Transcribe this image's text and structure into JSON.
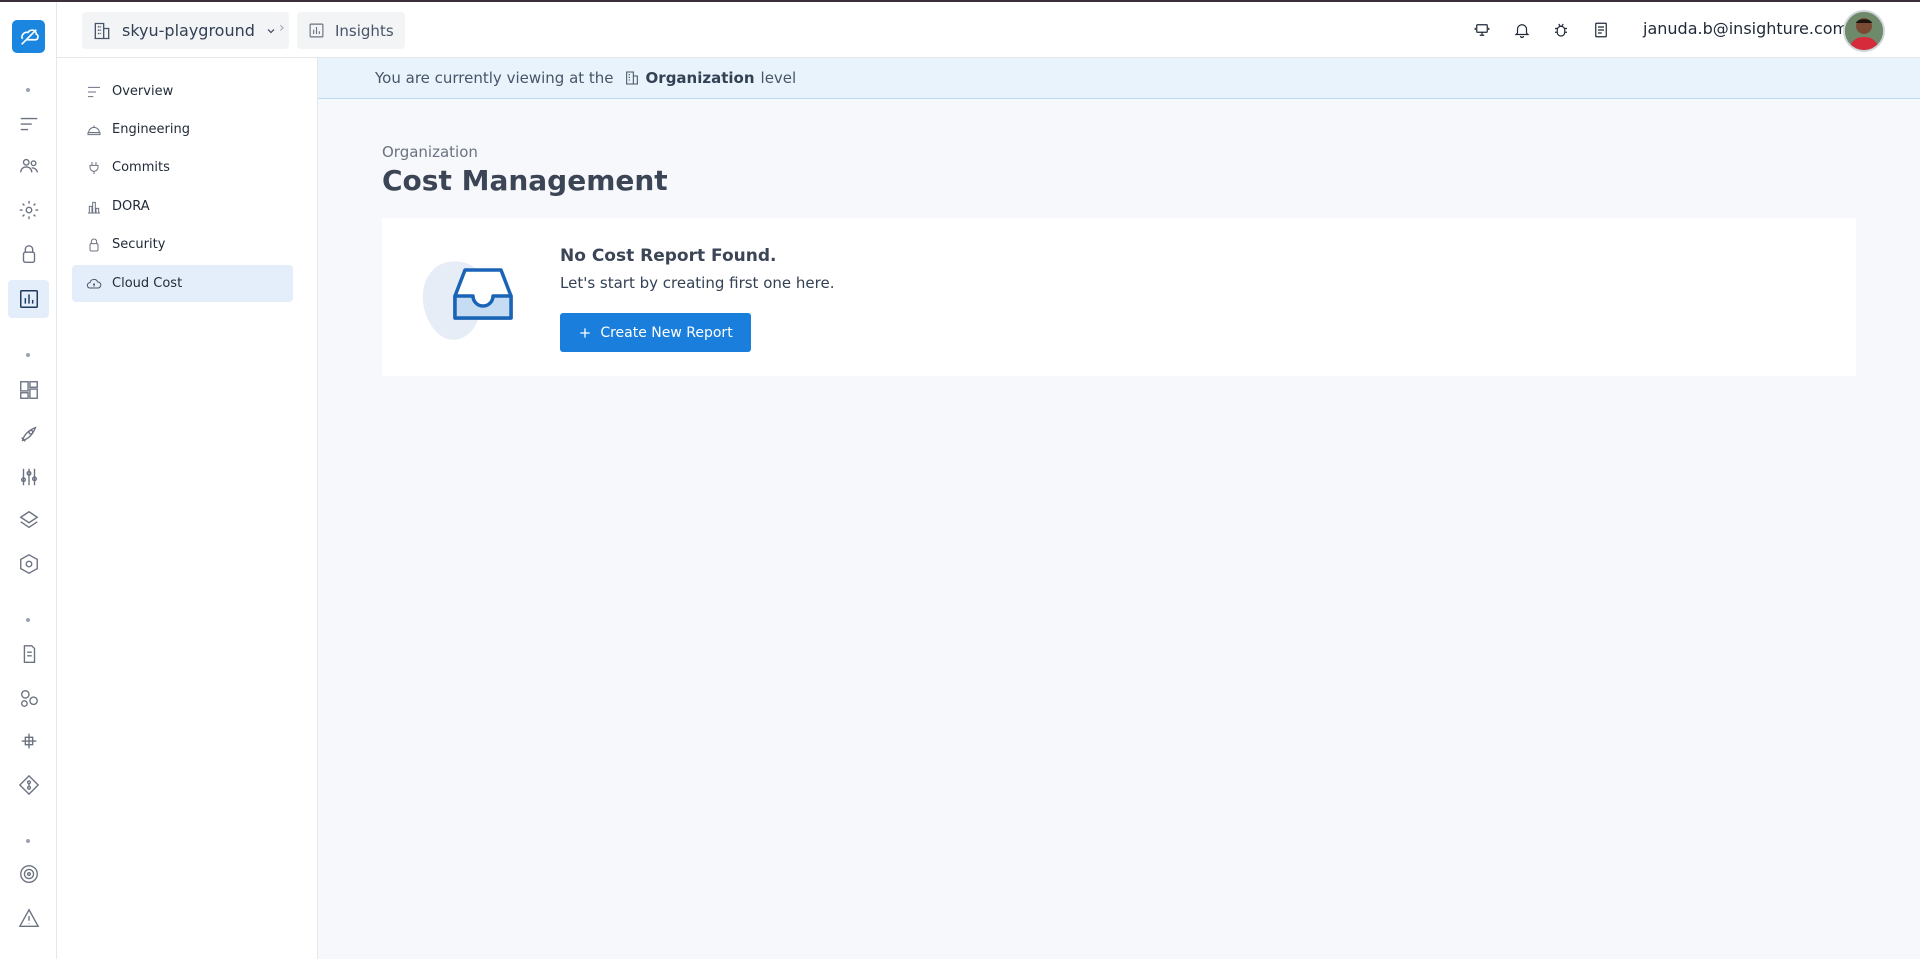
{
  "header": {
    "org_name": "skyu-playground",
    "breadcrumb": "Insights",
    "user_email": "januda.b@insighture.com"
  },
  "sidebar": {
    "items": [
      {
        "label": "Overview",
        "icon": "lines-icon"
      },
      {
        "label": "Engineering",
        "icon": "helmet-icon"
      },
      {
        "label": "Commits",
        "icon": "plug-icon"
      },
      {
        "label": "DORA",
        "icon": "chart-building-icon"
      },
      {
        "label": "Security",
        "icon": "lock-icon"
      },
      {
        "label": "Cloud Cost",
        "icon": "cloud-dollar-icon"
      }
    ],
    "active": "Cloud Cost"
  },
  "banner": {
    "prefix": "You are currently viewing at the",
    "level": "Organization",
    "suffix": "level"
  },
  "page": {
    "breadcrumb": "Organization",
    "title": "Cost Management"
  },
  "empty_state": {
    "title": "No Cost Report Found.",
    "subtitle": "Let's start by creating first one here.",
    "button_label": "Create New Report"
  },
  "colors": {
    "accent": "#1a7fdc",
    "active_bg": "#e4eefa",
    "banner_bg": "#e9f3fb"
  }
}
